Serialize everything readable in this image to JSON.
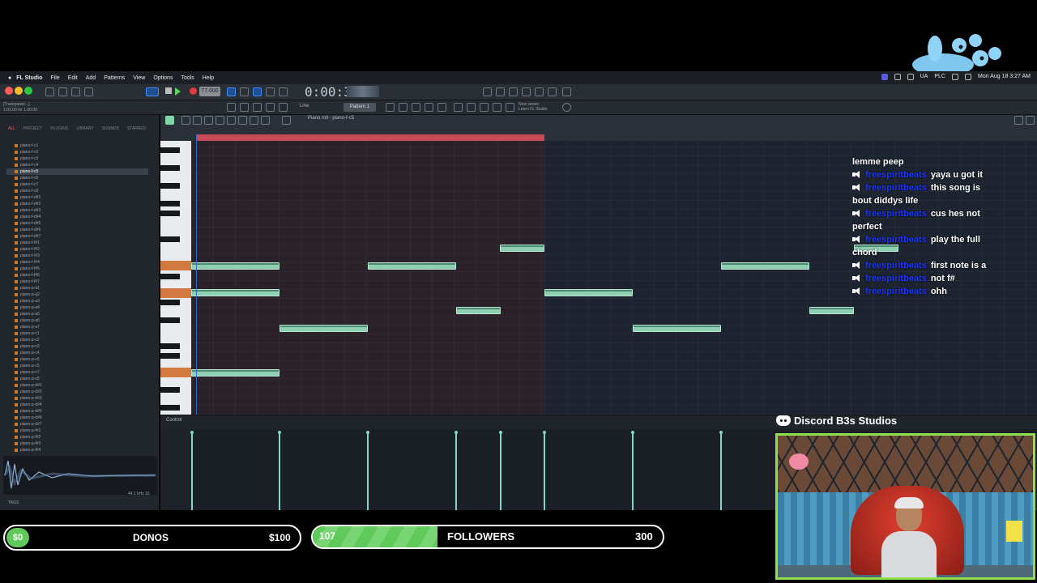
{
  "menubar": {
    "app": "FL Studio",
    "items": [
      "File",
      "Edit",
      "Add",
      "Patterns",
      "View",
      "Options",
      "Tools",
      "Help"
    ],
    "status": {
      "lang": "UA",
      "plc": "PLC",
      "datetime": "Mon Aug 18  3:27 AM"
    }
  },
  "toolbar": {
    "bpm": "77.000",
    "time": "0:00:30",
    "pattern": "Pattern 1",
    "news_line1": "New series:",
    "news_line2": "Learn FL Studio",
    "project_line1": "[Trackpulse/...]",
    "project_line2": "1:01:00 for 1:00:00",
    "snap": "Line"
  },
  "browser": {
    "tabs": [
      "ALL",
      "PROJECT",
      "PLUGINS",
      "LIBRARY",
      "SOUNDS",
      "STARRED"
    ],
    "active_tab": "ALL",
    "items": [
      "piano-f-c1",
      "piano-f-c2",
      "piano-f-c3",
      "piano-f-c4",
      "piano-f-c5",
      "piano-f-c6",
      "piano-f-c7",
      "piano-f-c8",
      "piano-f-d#1",
      "piano-f-d#2",
      "piano-f-d#3",
      "piano-f-d#4",
      "piano-f-d#5",
      "piano-f-d#6",
      "piano-f-d#7",
      "piano-f-f#1",
      "piano-f-f#2",
      "piano-f-f#3",
      "piano-f-f#4",
      "piano-f-f#5",
      "piano-f-f#6",
      "piano-f-f#7",
      "piano-p-a1",
      "piano-p-a2",
      "piano-p-a3",
      "piano-p-a4",
      "piano-p-a5",
      "piano-p-a6",
      "piano-p-a7",
      "piano-p-c1",
      "piano-p-c2",
      "piano-p-c3",
      "piano-p-c4",
      "piano-p-c5",
      "piano-p-c6",
      "piano-p-c7",
      "piano-p-c8",
      "piano-p-d#1",
      "piano-p-d#2",
      "piano-p-d#3",
      "piano-p-d#4",
      "piano-p-d#5",
      "piano-p-d#6",
      "piano-p-d#7",
      "piano-p-f#1",
      "piano-p-f#2",
      "piano-p-f#3",
      "piano-p-f#4"
    ],
    "selected": "piano-f-c5",
    "tags_label": "TAGS",
    "sample_rate": "44.1 kHz 16"
  },
  "piano_roll": {
    "title": "Piano roll - piano-f-c5",
    "control_label": "Control"
  },
  "chat": {
    "header": "lemme peep",
    "messages": [
      {
        "user": "freespiritbeats",
        "text": "yaya u got it"
      },
      {
        "user": "freespiritbeats",
        "text": "this song is bout diddys life"
      },
      {
        "user": "freespiritbeats",
        "text": "cus hes not perfect"
      },
      {
        "user": "freespiritbeats",
        "text": "play the full chord"
      },
      {
        "user": "freespiritbeats",
        "text": "first note is a"
      },
      {
        "user": "freespiritbeats",
        "text": "not f#"
      },
      {
        "user": "freespiritbeats",
        "text": "ohh"
      }
    ]
  },
  "discord": {
    "label": "Discord B3s Studios"
  },
  "donos": {
    "current": "$0",
    "label": "DONOS",
    "goal": "$100",
    "progress": 0.0
  },
  "followers": {
    "current": "107",
    "label": "FOLLOWERS",
    "goal": "300",
    "progress": 0.357
  },
  "colors": {
    "note": "#8fd0b5",
    "loop": "#c74a57",
    "goal_fill": "#5fc95a",
    "chat_name": "#1d35ff"
  }
}
